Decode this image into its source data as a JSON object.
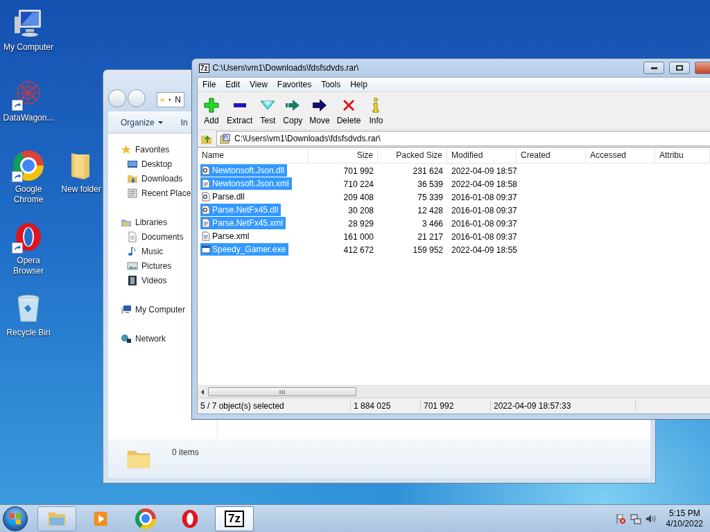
{
  "desktop_icons": [
    {
      "label": "My Computer",
      "kind": "computer",
      "shortcut": false
    },
    {
      "label": "DataWagon...",
      "kind": "network-ball",
      "shortcut": true
    },
    {
      "label": "Google Chrome",
      "kind": "chrome",
      "shortcut": true
    },
    {
      "label": "New folder",
      "kind": "folder",
      "shortcut": false
    },
    {
      "label": "Opera Browser",
      "kind": "opera",
      "shortcut": true
    },
    {
      "label": "Recycle Bin",
      "kind": "bin",
      "shortcut": false
    }
  ],
  "explorer_window": {
    "address": "N",
    "toolbar": [
      "Organize",
      "In"
    ],
    "nav": [
      {
        "label": "Favorites",
        "kind": "star",
        "children": [
          {
            "label": "Desktop",
            "kind": "desktop"
          },
          {
            "label": "Downloads",
            "kind": "downloads"
          },
          {
            "label": "Recent Place",
            "kind": "recent"
          }
        ]
      },
      {
        "label": "Libraries",
        "kind": "library",
        "children": [
          {
            "label": "Documents",
            "kind": "documents"
          },
          {
            "label": "Music",
            "kind": "music"
          },
          {
            "label": "Pictures",
            "kind": "pictures"
          },
          {
            "label": "Videos",
            "kind": "videos"
          }
        ]
      },
      {
        "label": "My Computer",
        "kind": "computer"
      },
      {
        "label": "Network",
        "kind": "network"
      }
    ],
    "status": "0 items"
  },
  "archive_window": {
    "logo": "7z",
    "title": "C:\\Users\\vm1\\Downloads\\fdsfsdvds.rar\\",
    "menu": [
      "File",
      "Edit",
      "View",
      "Favorites",
      "Tools",
      "Help"
    ],
    "toolbar": [
      {
        "label": "Add",
        "kind": "add"
      },
      {
        "label": "Extract",
        "kind": "extract"
      },
      {
        "label": "Test",
        "kind": "test"
      },
      {
        "label": "Copy",
        "kind": "copy"
      },
      {
        "label": "Move",
        "kind": "move"
      },
      {
        "label": "Delete",
        "kind": "delete"
      },
      {
        "label": "Info",
        "kind": "info"
      }
    ],
    "path": "C:\\Users\\vm1\\Downloads\\fdsfsdvds.rar\\",
    "columns": [
      "Name",
      "Size",
      "Packed Size",
      "Modified",
      "Created",
      "Accessed",
      "Attribu"
    ],
    "files": [
      {
        "name": "Newtonsoft.Json.dll",
        "kind": "dll",
        "size": "701 992",
        "packed": "231 624",
        "modified": "2022-04-09 18:57",
        "selected": true
      },
      {
        "name": "Newtonsoft.Json.xml",
        "kind": "xml",
        "size": "710 224",
        "packed": "36 539",
        "modified": "2022-04-09 18:58",
        "selected": true
      },
      {
        "name": "Parse.dll",
        "kind": "dll",
        "size": "209 408",
        "packed": "75 339",
        "modified": "2016-01-08 09:37",
        "selected": false
      },
      {
        "name": "Parse.NetFx45.dll",
        "kind": "dll",
        "size": "30 208",
        "packed": "12 428",
        "modified": "2016-01-08 09:37",
        "selected": true
      },
      {
        "name": "Parse.NetFx45.xml",
        "kind": "xml",
        "size": "28 929",
        "packed": "3 466",
        "modified": "2016-01-08 09:37",
        "selected": true
      },
      {
        "name": "Parse.xml",
        "kind": "xml",
        "size": "161 000",
        "packed": "21 217",
        "modified": "2016-01-08 09:37",
        "selected": false
      },
      {
        "name": "Speedy_Gamer.exe",
        "kind": "exe",
        "size": "412 672",
        "packed": "159 952",
        "modified": "2022-04-09 18:55",
        "selected": true
      }
    ],
    "status": [
      "5 / 7 object(s) selected",
      "1 884 025",
      "701 992",
      "2022-04-09 18:57:33"
    ]
  },
  "taskbar": {
    "apps": [
      {
        "kind": "explorer",
        "running": true,
        "selected": false
      },
      {
        "kind": "media",
        "running": false,
        "selected": false
      },
      {
        "kind": "chrome",
        "running": false,
        "selected": false
      },
      {
        "kind": "opera",
        "running": false,
        "selected": false
      },
      {
        "kind": "archiver",
        "label": "7z",
        "running": true,
        "selected": true
      }
    ],
    "clock": {
      "time": "5:15 PM",
      "date": "4/10/2022"
    }
  }
}
